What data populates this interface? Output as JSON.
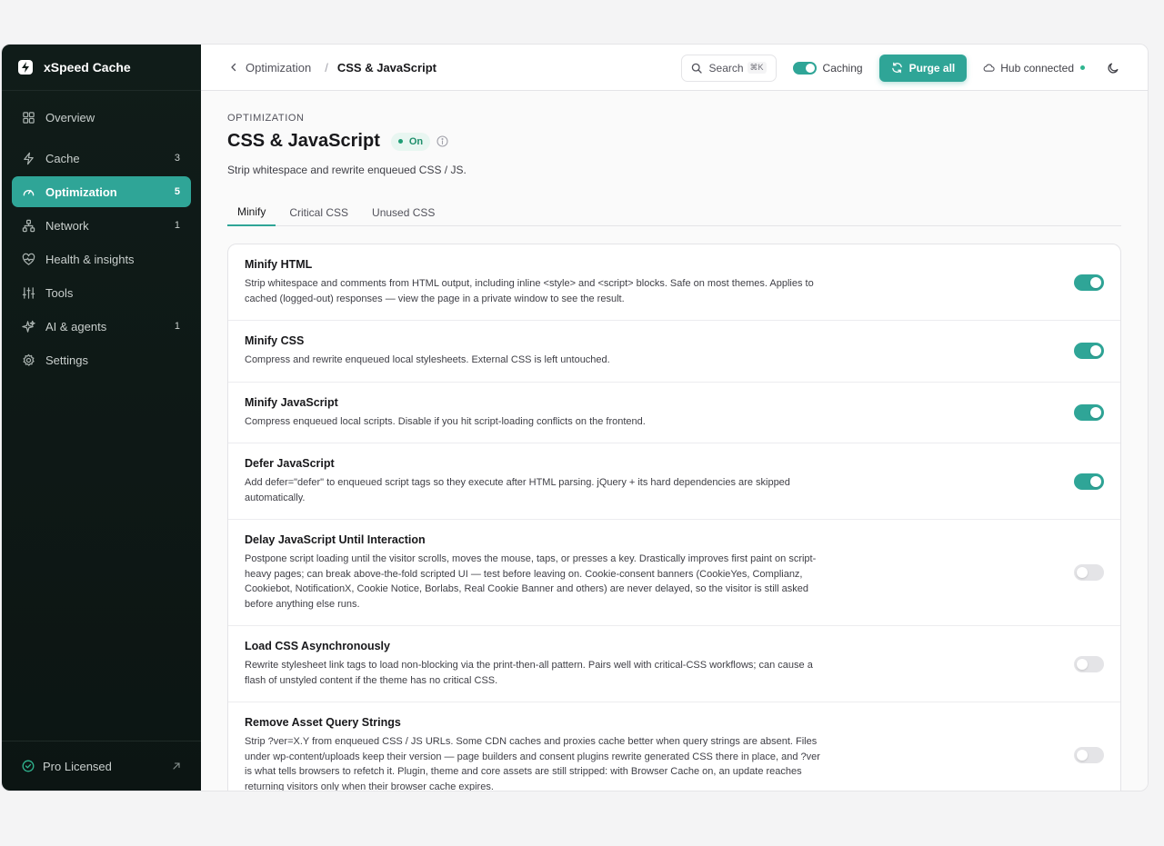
{
  "brand": {
    "name": "xSpeed Cache"
  },
  "sidebar": {
    "items": [
      {
        "label": "Overview",
        "count": "",
        "icon": "grid-icon"
      },
      {
        "label": "Cache",
        "count": "3",
        "icon": "bolt-icon"
      },
      {
        "label": "Optimization",
        "count": "5",
        "icon": "gauge-icon"
      },
      {
        "label": "Network",
        "count": "1",
        "icon": "network-icon"
      },
      {
        "label": "Health & insights",
        "count": "",
        "icon": "heart-pulse-icon"
      },
      {
        "label": "Tools",
        "count": "",
        "icon": "sliders-icon"
      },
      {
        "label": "AI & agents",
        "count": "1",
        "icon": "sparkles-icon"
      },
      {
        "label": "Settings",
        "count": "",
        "icon": "gear-icon"
      }
    ],
    "footer": {
      "label": "Pro Licensed"
    }
  },
  "topbar": {
    "breadcrumb": {
      "parent": "Optimization",
      "separator": "/",
      "current": "CSS & JavaScript"
    },
    "search": {
      "label": "Search",
      "shortcut": "⌘K"
    },
    "caching_label": "Caching",
    "purge_label": "Purge all",
    "hub_label": "Hub connected"
  },
  "page": {
    "section": "OPTIMIZATION",
    "title": "CSS & JavaScript",
    "status": "On",
    "description": "Strip whitespace and rewrite enqueued CSS / JS."
  },
  "tabs": [
    {
      "label": "Minify",
      "active": true
    },
    {
      "label": "Critical CSS",
      "active": false
    },
    {
      "label": "Unused CSS",
      "active": false
    }
  ],
  "settings": [
    {
      "title": "Minify HTML",
      "description": "Strip whitespace and comments from HTML output, including inline <style> and <script> blocks. Safe on most themes. Applies to cached (logged-out) responses — view the page in a private window to see the result.",
      "enabled": true
    },
    {
      "title": "Minify CSS",
      "description": "Compress and rewrite enqueued local stylesheets. External CSS is left untouched.",
      "enabled": true
    },
    {
      "title": "Minify JavaScript",
      "description": "Compress enqueued local scripts. Disable if you hit script-loading conflicts on the frontend.",
      "enabled": true
    },
    {
      "title": "Defer JavaScript",
      "description": "Add defer=\"defer\" to enqueued script tags so they execute after HTML parsing. jQuery + its hard dependencies are skipped automatically.",
      "enabled": true
    },
    {
      "title": "Delay JavaScript Until Interaction",
      "description": "Postpone script loading until the visitor scrolls, moves the mouse, taps, or presses a key. Drastically improves first paint on script-heavy pages; can break above-the-fold scripted UI — test before leaving on. Cookie-consent banners (CookieYes, Complianz, Cookiebot, NotificationX, Cookie Notice, Borlabs, Real Cookie Banner and others) are never delayed, so the visitor is still asked before anything else runs.",
      "enabled": false
    },
    {
      "title": "Load CSS Asynchronously",
      "description": "Rewrite stylesheet link tags to load non-blocking via the print-then-all pattern. Pairs well with critical-CSS workflows; can cause a flash of unstyled content if the theme has no critical CSS.",
      "enabled": false
    },
    {
      "title": "Remove Asset Query Strings",
      "description": "Strip ?ver=X.Y from enqueued CSS / JS URLs. Some CDN caches and proxies cache better when query strings are absent. Files under wp-content/uploads keep their version — page builders and consent plugins rewrite generated CSS there in place, and ?ver is what tells browsers to refetch it. Plugin, theme and core assets are still stripped: with Browser Cache on, an update reaches returning visitors only when their browser cache expires.",
      "enabled": false
    }
  ],
  "colors": {
    "accent": "#2fa597",
    "sidebar_bg": "#101c19",
    "success": "#1f9d75"
  }
}
